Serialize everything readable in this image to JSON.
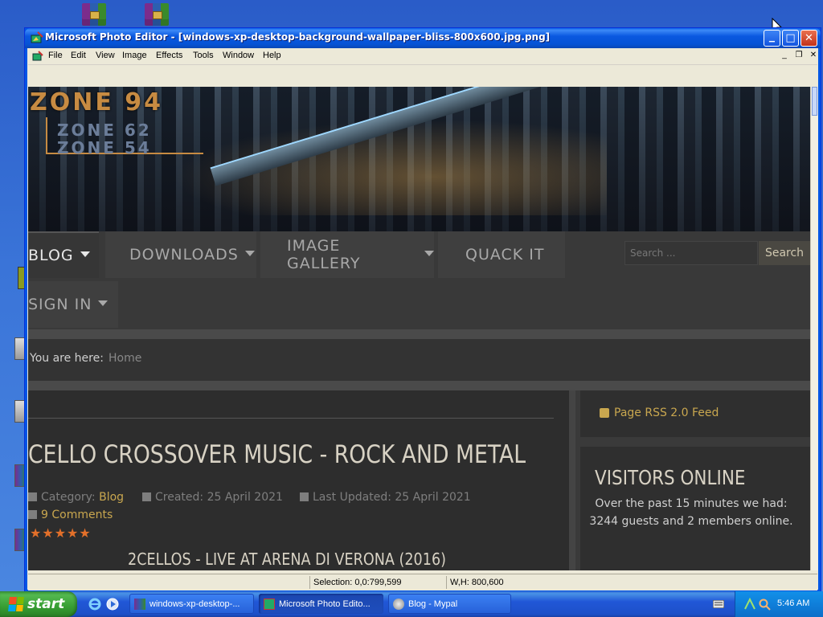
{
  "window": {
    "title": "Microsoft Photo Editor - [windows-xp-desktop-background-wallpaper-bliss-800x600.jpg.png]",
    "min_glyph": "▁",
    "max_glyph": "□",
    "close_glyph": "✕"
  },
  "menu": {
    "items": [
      "File",
      "Edit",
      "View",
      "Image",
      "Effects",
      "Tools",
      "Window",
      "Help"
    ],
    "mdi_min": "_",
    "mdi_restore": "❐",
    "mdi_close": "✕"
  },
  "image": {
    "logo_main": "ZONE 94",
    "logo_sub1": "ZONE 62",
    "logo_sub2": "ZONE 54",
    "nav": {
      "blog": "BLOG",
      "downloads": "DOWNLOADS",
      "image_gallery": "IMAGE GALLERY",
      "quack_it": "QUACK IT",
      "sign_in": "SIGN IN"
    },
    "search_placeholder": "Search ...",
    "search_button": "Search",
    "breadcrumb_label": "You are here:",
    "breadcrumb_home": "Home",
    "article_title": "CELLO CROSSOVER MUSIC - ROCK AND METAL",
    "category_label": "Category: ",
    "category_value": "Blog",
    "created": "Created: 25 April 2021",
    "updated": "Last Updated: 25 April 2021",
    "comments": "9 Comments",
    "stars": "★★★★★",
    "video_title": "2CELLOS - LIVE AT ARENA DI VERONA (2016)",
    "rss": "Page RSS 2.0 Feed",
    "visitors_title": "VISITORS ONLINE",
    "visitors_text": "Over the past 15 minutes we had: 3244 guests and 2 members online."
  },
  "status": {
    "empty": "",
    "selection": "Selection: 0,0:799,599",
    "size": "W,H: 800,600"
  },
  "taskbar": {
    "start": "start",
    "tasks": [
      "windows-xp-desktop-...",
      "Microsoft Photo Edito...",
      "Blog - Mypal"
    ],
    "clock": "5:46 AM"
  },
  "colors": {
    "xp_blue": "#0a58e0",
    "start_green": "#379e33",
    "accent_gold": "#c9a74f",
    "star_orange": "#e3702a"
  }
}
